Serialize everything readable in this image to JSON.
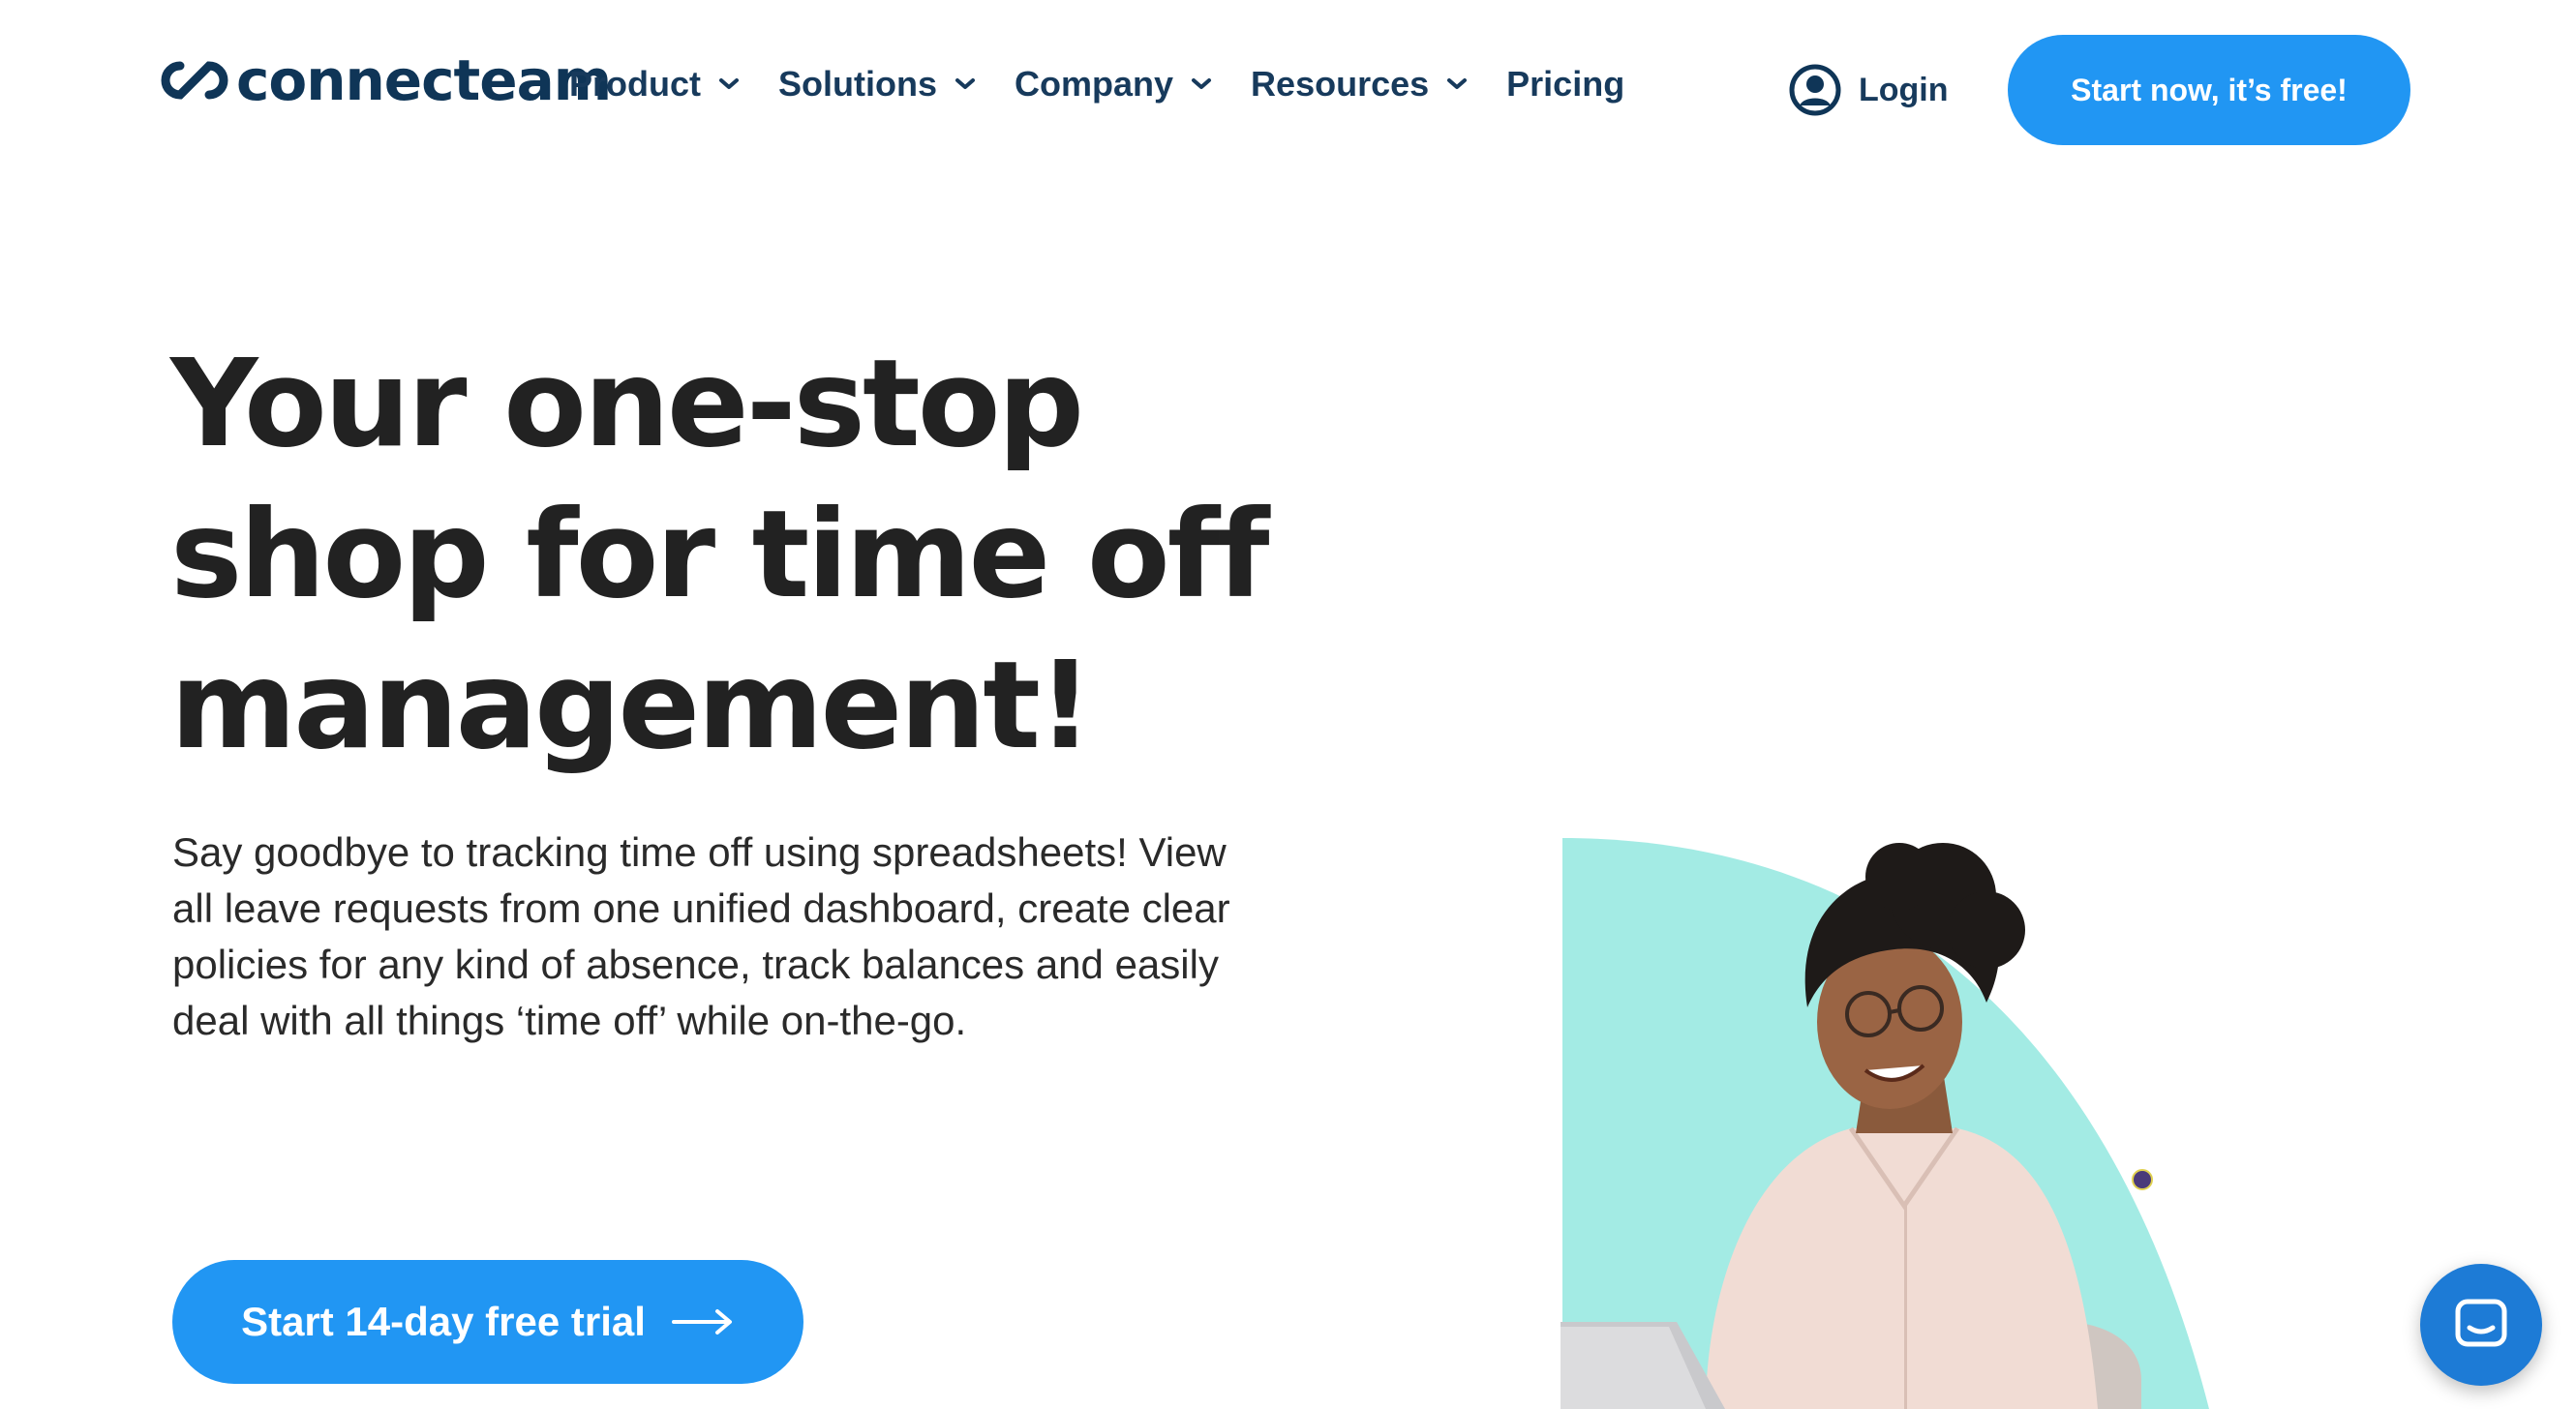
{
  "brand": {
    "logo_text": "connecteam",
    "accent_color": "#2196f3",
    "navy_color": "#173a5c",
    "illustration_bg_color": "#a3ebe4"
  },
  "nav": {
    "items": [
      {
        "label": "Product",
        "has_dropdown": true
      },
      {
        "label": "Solutions",
        "has_dropdown": true
      },
      {
        "label": "Company",
        "has_dropdown": true
      },
      {
        "label": "Resources",
        "has_dropdown": true
      },
      {
        "label": "Pricing",
        "has_dropdown": false
      }
    ],
    "login_label": "Login",
    "login_icon": "user-circle-icon",
    "cta_label": "Start now, it’s free!"
  },
  "hero": {
    "title_lines": [
      "Your one-stop",
      "shop for time off",
      "management!"
    ],
    "description": "Say goodbye to tracking time off using spreadsheets! View all leave requests from one unified dashboard, create clear policies for any kind of absence, track balances and easily deal with all things ‘time off’ while on-the-go.",
    "cta_label": "Start 14-day free trial",
    "cta_icon": "arrow-right-icon"
  },
  "chat_launcher": {
    "icon": "chat-icon"
  }
}
